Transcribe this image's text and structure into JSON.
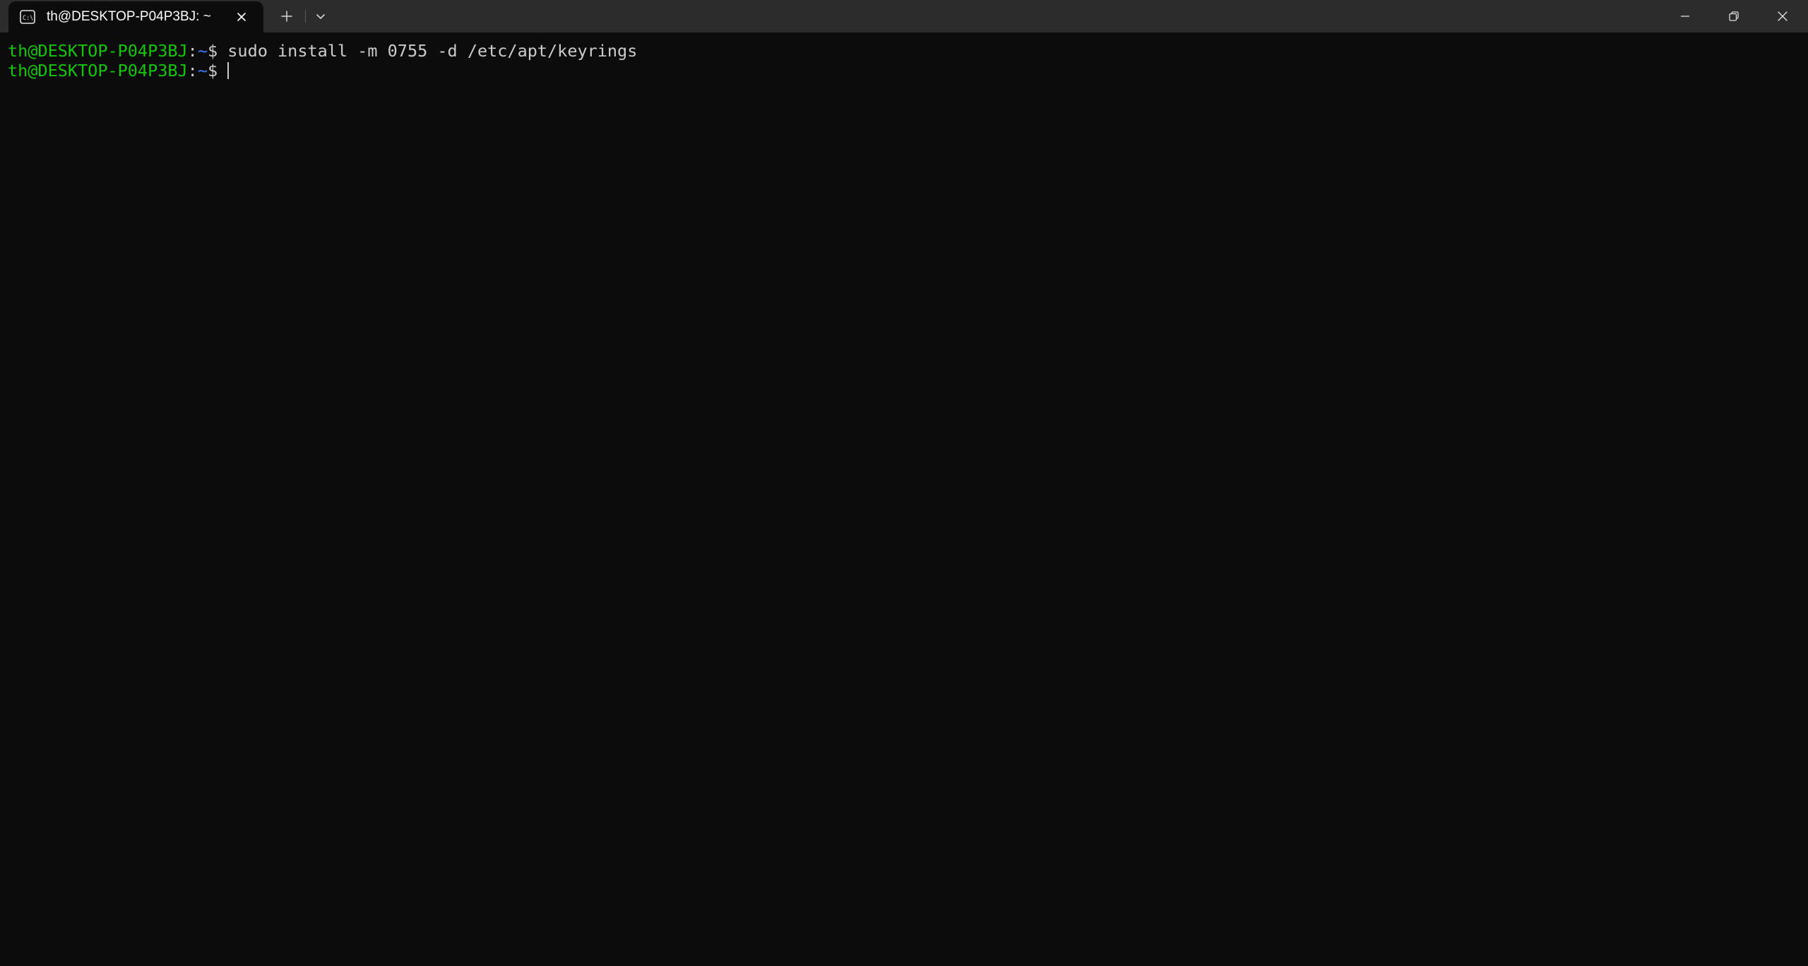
{
  "window": {
    "tab_title": "th@DESKTOP-P04P3BJ: ~",
    "tab_icon": "terminal-icon",
    "controls": [
      "minimize-icon",
      "restore-icon",
      "close-icon"
    ]
  },
  "terminal": {
    "lines": [
      {
        "user_host": "th@DESKTOP-P04P3BJ",
        "colon": ":",
        "path": "~",
        "prompt_symbol": "$ ",
        "command": "sudo install -m 0755 -d /etc/apt/keyrings"
      },
      {
        "user_host": "th@DESKTOP-P04P3BJ",
        "colon": ":",
        "path": "~",
        "prompt_symbol": "$ ",
        "command": ""
      }
    ]
  },
  "colors": {
    "background": "#0c0c0c",
    "titlebar": "#2c2c2c",
    "user_host": "#16c60c",
    "path": "#3b78ff",
    "text": "#cccccc"
  }
}
